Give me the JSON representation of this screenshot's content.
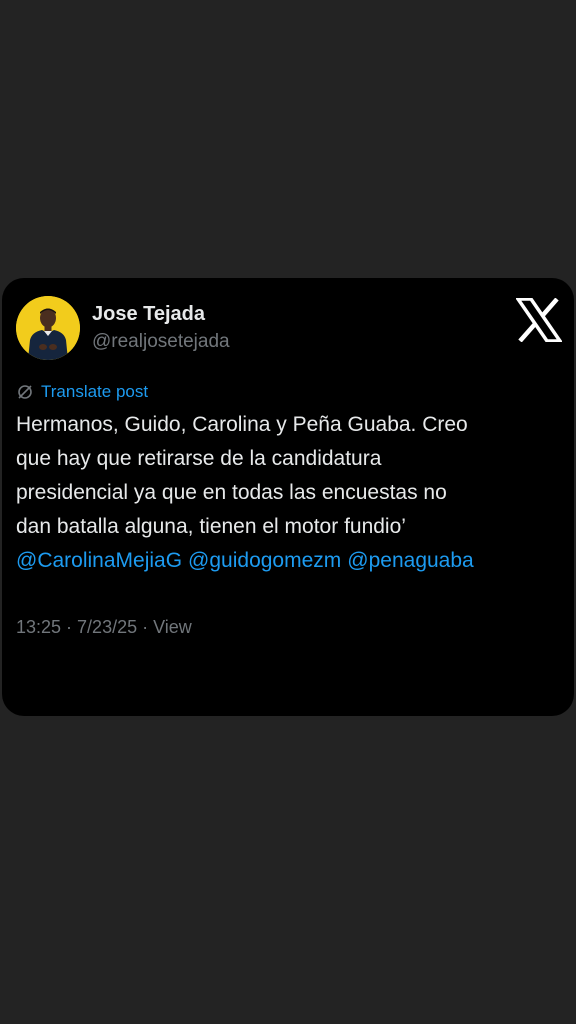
{
  "post": {
    "author": {
      "display_name": "Jose Tejada",
      "handle": "@realjosetejada",
      "avatar_icon": "user-avatar-photo",
      "avatar_bg": "#f2cc1c"
    },
    "platform_icon": "x-logo-icon",
    "translate_label": "Translate post",
    "body_lines": [
      "Hermanos, Guido, Carolina y Peña Guaba. Creo",
      "que hay que retirarse de la candidatura",
      "presidencial ya que en todas las encuestas no",
      "dan batalla alguna, tienen el motor fundio’"
    ],
    "mentions": [
      "@CarolinaMejiaG",
      "@guidogomezm",
      "@penaguaba"
    ],
    "time": "13:25",
    "separator": " · ",
    "date": "7/23/25",
    "view_label": "View"
  },
  "colors": {
    "page_bg": "#232323",
    "card_bg": "#000000",
    "text_primary": "#e7e9ea",
    "text_secondary": "#71767b",
    "link": "#1d9bf0"
  }
}
